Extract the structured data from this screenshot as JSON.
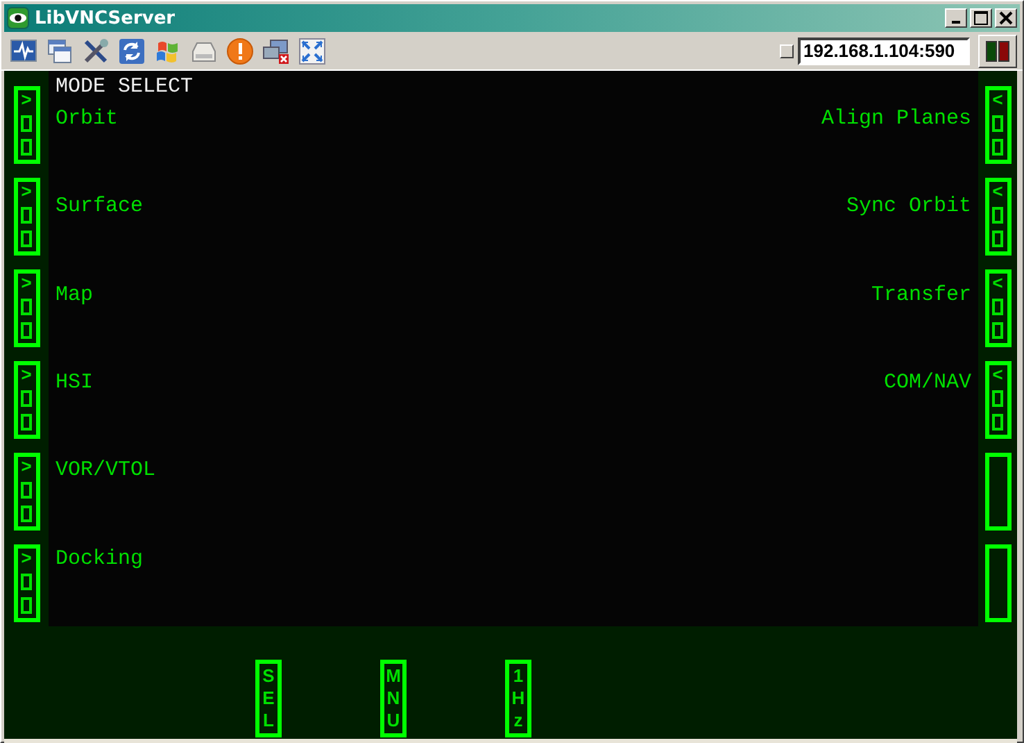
{
  "window": {
    "title": "LibVNCServer"
  },
  "toolbar": {
    "address": "192.168.1.104:590"
  },
  "screen": {
    "header": "MODE SELECT",
    "left_options": [
      "Orbit",
      "Surface",
      "Map",
      "HSI",
      "VOR/VTOL",
      "Docking"
    ],
    "right_options": [
      "Align Planes",
      "Sync Orbit",
      "Transfer",
      "COM/NAV"
    ],
    "left_buttons": [
      {
        "kind": "arrow",
        "label": ">"
      },
      {
        "kind": "arrow",
        "label": ">"
      },
      {
        "kind": "arrow",
        "label": ">"
      },
      {
        "kind": "arrow",
        "label": ">"
      },
      {
        "kind": "arrow",
        "label": ">"
      },
      {
        "kind": "arrow",
        "label": ">"
      }
    ],
    "right_buttons": [
      {
        "kind": "arrow",
        "label": "<"
      },
      {
        "kind": "arrow",
        "label": "<"
      },
      {
        "kind": "arrow",
        "label": "<"
      },
      {
        "kind": "arrow",
        "label": "<"
      },
      {
        "kind": "blank"
      },
      {
        "kind": "blank"
      }
    ],
    "bottom_buttons": [
      "SEL",
      "MNU",
      "1Hz"
    ]
  }
}
